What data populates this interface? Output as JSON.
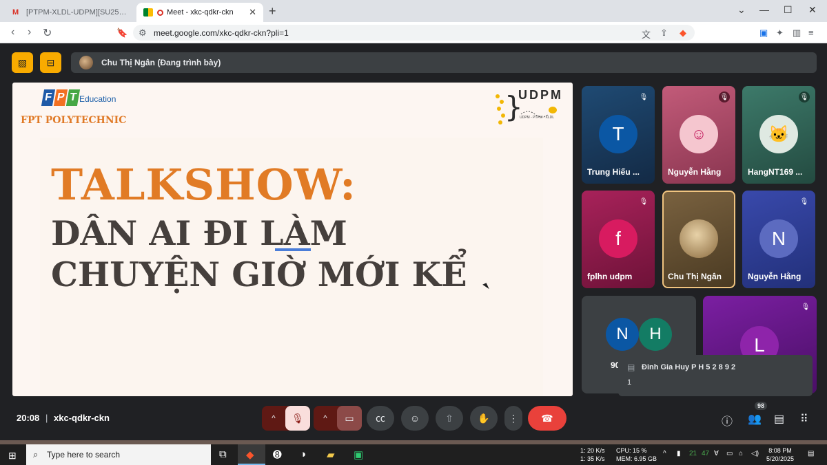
{
  "browser": {
    "tabs": [
      {
        "title": "[PTPM-XLDL-UDPM][SU25]THƯ MỜI THAM DỰ",
        "icon": "gmail-icon",
        "active": false
      },
      {
        "title": "Meet - xkc-qdkr-ckn",
        "icon": "meet-icon",
        "active": true
      }
    ],
    "url": "meet.google.com/xkc-qdkr-ckn?pli=1"
  },
  "meet": {
    "presenter_label": "Chu Thị Ngân (Đang trình bày)",
    "clock": "20:08",
    "meeting_code": "xkc-qdkr-ckn",
    "people_count": "98",
    "slide": {
      "brand_letters": [
        "F",
        "P",
        "T"
      ],
      "brand_colors": [
        "#1e5aa8",
        "#f37021",
        "#46a744"
      ],
      "education": "Education",
      "polytechnic": "FPT POLYTECHNIC",
      "udpm_title": "UDPM",
      "udpm_sub": "UDPM - PTPM - XLDL",
      "line1": "TALKSHOW:",
      "line2": "DÂN AI ĐI LÀM",
      "line3": "CHUYỆN GIỜ MỚI KỂ"
    },
    "participants": [
      {
        "name": "Trung Hiếu ...",
        "initial": "T",
        "bg": "#1a3a5c",
        "avatar_color": "#0b57a4",
        "muted": true
      },
      {
        "name": "Nguyễn Hằng",
        "initial": "",
        "bg": "#b04a68",
        "avatar_color": "#f5c6cf",
        "muted": true
      },
      {
        "name": "HangNT169 ...",
        "initial": "",
        "bg": "#2f5e52",
        "avatar_color": "#dfe9e2",
        "muted": true
      },
      {
        "name": "fplhn udpm",
        "initial": "f",
        "bg": "#8e1a4c",
        "avatar_color": "#d81b60",
        "muted": true
      },
      {
        "name": "Chu Thị Ngân",
        "initial": "",
        "bg": "#6a5434",
        "avatar_color": "#c7a877",
        "muted": false
      },
      {
        "name": "Nguyễn Hằng",
        "initial": "N",
        "bg": "#2b3b8a",
        "avatar_color": "#5c6bc0",
        "muted": true
      }
    ],
    "others_tile": {
      "label": "90",
      "initials": [
        "N",
        "H"
      ],
      "colors": [
        "#0b57a4",
        "#137c64"
      ]
    },
    "last_tile": {
      "initial": "L",
      "bg": "#6b1b8e"
    },
    "chat_toast": {
      "sender": "Đinh Gia Huy P H 5 2 8 9 2",
      "message": "1"
    }
  },
  "taskbar": {
    "search_placeholder": "Type here to search",
    "net_up": "1: 20 K/s",
    "net_down": "1: 35 K/s",
    "cpu": "CPU: 15 %",
    "mem": "MEM: 6.95 GB",
    "tray_temp": "21",
    "tray_num": "47",
    "time": "8:08 PM",
    "date": "5/20/2025"
  }
}
